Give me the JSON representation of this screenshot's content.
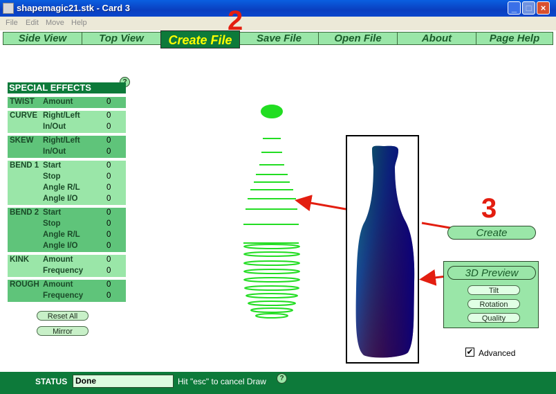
{
  "window": {
    "title": "shapemagic21.stk - Card 3",
    "btn_min": "_",
    "btn_max": "□",
    "btn_close": "×"
  },
  "menu": [
    "File",
    "Edit",
    "Move",
    "Help"
  ],
  "nav": [
    {
      "label": "Side View",
      "active": false
    },
    {
      "label": "Top View",
      "active": false
    },
    {
      "label": "Create File",
      "active": true
    },
    {
      "label": "Save File",
      "active": false
    },
    {
      "label": "Open File",
      "active": false
    },
    {
      "label": "About",
      "active": false
    },
    {
      "label": "Page Help",
      "active": false
    }
  ],
  "annotations": {
    "step2": "2",
    "step3": "3"
  },
  "help_mark": "?",
  "effects": {
    "title": "SPECIAL EFFECTS",
    "groups": [
      {
        "name": "TWIST",
        "params": [
          {
            "label": "Amount",
            "value": "0"
          }
        ]
      },
      {
        "name": "CURVE",
        "params": [
          {
            "label": "Right/Left",
            "value": "0"
          },
          {
            "label": "In/Out",
            "value": "0"
          }
        ]
      },
      {
        "name": "SKEW",
        "params": [
          {
            "label": "Right/Left",
            "value": "0"
          },
          {
            "label": "In/Out",
            "value": "0"
          }
        ]
      },
      {
        "name": "BEND 1",
        "params": [
          {
            "label": "Start",
            "value": "0"
          },
          {
            "label": "Stop",
            "value": "0"
          },
          {
            "label": "Angle R/L",
            "value": "0"
          },
          {
            "label": "Angle I/O",
            "value": "0"
          }
        ]
      },
      {
        "name": "BEND 2",
        "params": [
          {
            "label": "Start",
            "value": "0"
          },
          {
            "label": "Stop",
            "value": "0"
          },
          {
            "label": "Angle R/L",
            "value": "0"
          },
          {
            "label": "Angle I/O",
            "value": "0"
          }
        ]
      },
      {
        "name": "KINK",
        "params": [
          {
            "label": "Amount",
            "value": "0"
          },
          {
            "label": "Frequency",
            "value": "0"
          }
        ]
      },
      {
        "name": "ROUGH",
        "params": [
          {
            "label": "Amount",
            "value": "0"
          },
          {
            "label": "Frequency",
            "value": "0"
          }
        ]
      }
    ]
  },
  "buttons": {
    "reset": "Reset All",
    "mirror": "Mirror",
    "create": "Create",
    "preview3d": "3D Preview",
    "tilt": "Tilt",
    "rotation": "Rotation",
    "quality": "Quality"
  },
  "advanced": {
    "label": "Advanced",
    "checked": true,
    "mark": "✔"
  },
  "status": {
    "label": "STATUS",
    "value": "Done",
    "hint": "Hit \"esc\" to cancel Draw"
  },
  "colors": {
    "panel_dark": "#0d7a3a",
    "panel_light": "#9ae6a8",
    "annotation": "#e31e10",
    "wire": "#22dd22"
  }
}
